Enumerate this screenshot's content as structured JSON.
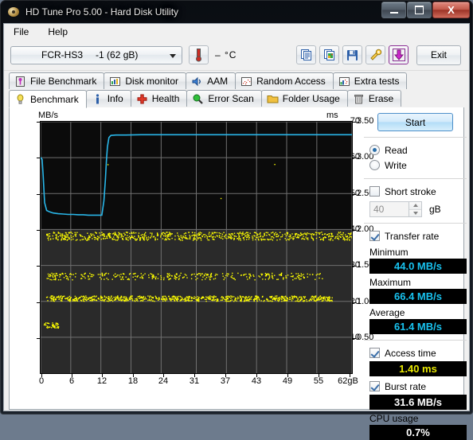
{
  "window": {
    "title": "HD Tune Pro 5.00 - Hard Disk Utility",
    "minimize_label": "Minimize",
    "maximize_label": "Maximize",
    "close_label": "X"
  },
  "menu": {
    "items": [
      {
        "label": "File"
      },
      {
        "label": "Help"
      }
    ]
  },
  "toolbar": {
    "device_name": "FCR-HS3",
    "device_detail": "-1 (62 gB)",
    "temperature": "– °C",
    "buttons": [
      {
        "name": "copy-button",
        "label": "Copy"
      },
      {
        "name": "copy-image-button",
        "label": "Copy image"
      },
      {
        "name": "save-button",
        "label": "Save"
      },
      {
        "name": "settings-button",
        "label": "Options"
      },
      {
        "name": "download-button",
        "label": "Download"
      }
    ],
    "exit_label": "Exit"
  },
  "tabs": {
    "row1": [
      {
        "label": "File Benchmark",
        "icon": "file-benchmark-icon"
      },
      {
        "label": "Disk monitor",
        "icon": "disk-monitor-icon"
      },
      {
        "label": "AAM",
        "icon": "aam-speaker-icon"
      },
      {
        "label": "Random Access",
        "icon": "random-access-icon"
      },
      {
        "label": "Extra tests",
        "icon": "extra-tests-icon"
      }
    ],
    "row2": [
      {
        "label": "Benchmark",
        "icon": "benchmark-bulb-icon",
        "active": true
      },
      {
        "label": "Info",
        "icon": "info-icon",
        "active": false
      },
      {
        "label": "Health",
        "icon": "health-cross-icon",
        "active": false
      },
      {
        "label": "Error Scan",
        "icon": "error-scan-magnifier-icon",
        "active": false
      },
      {
        "label": "Folder Usage",
        "icon": "folder-usage-icon",
        "active": false
      },
      {
        "label": "Erase",
        "icon": "erase-trash-icon",
        "active": false
      }
    ]
  },
  "results": {
    "start_label": "Start",
    "read_label": "Read",
    "write_label": "Write",
    "read_selected": true,
    "short_stroke_label": "Short stroke",
    "short_stroke_checked": false,
    "short_stroke_value": "40",
    "short_stroke_unit": "gB",
    "transfer_rate_label": "Transfer rate",
    "transfer_rate_checked": true,
    "minimum_label": "Minimum",
    "minimum_value": "44.0 MB/s",
    "maximum_label": "Maximum",
    "maximum_value": "66.4 MB/s",
    "average_label": "Average",
    "average_value": "61.4 MB/s",
    "access_time_label": "Access time",
    "access_time_checked": true,
    "access_time_value": "1.40 ms",
    "burst_rate_label": "Burst rate",
    "burst_rate_checked": true,
    "burst_rate_value": "31.6 MB/s",
    "cpu_usage_label": "CPU usage",
    "cpu_usage_value": "0.7%"
  },
  "colors": {
    "transfer_curve": "#29b6e8",
    "access_dots": "#ffff00",
    "plot_background": "#1c1c1c",
    "grid": "#6e6e6e",
    "value_cyan": "#18c3f0",
    "value_yellow": "#e8e800"
  },
  "chart_data": {
    "type": "line",
    "title": "",
    "ylabel": "MB/s",
    "y2label": "ms",
    "xlabel": "gB",
    "grid": true,
    "xlim": [
      0,
      62
    ],
    "ylim": [
      0,
      70
    ],
    "y2lim": [
      0,
      3.75
    ],
    "xticks": [
      0,
      6,
      12,
      18,
      24,
      31,
      37,
      43,
      49,
      55,
      62
    ],
    "xticklabels": [
      "0",
      "6",
      "12",
      "18",
      "24",
      "31",
      "37",
      "43",
      "49",
      "55",
      "62gB"
    ],
    "yticks": [
      10,
      20,
      30,
      40,
      50,
      60,
      70
    ],
    "yticklabels": [
      "10",
      "20",
      "30",
      "40",
      "50",
      "60",
      "70"
    ],
    "y2ticks": [
      0.5,
      1.0,
      1.5,
      2.0,
      2.5,
      3.0,
      3.5
    ],
    "y2ticklabels": [
      "0.50",
      "1.00",
      "1.50",
      "2.00",
      "2.50",
      "3.00",
      "3.50"
    ],
    "series": [
      {
        "name": "Transfer rate",
        "axis": "left",
        "units": "MB/s",
        "color": "#29b6e8",
        "x": [
          0.0,
          0.15,
          0.3,
          0.5,
          0.8,
          1.2,
          1.8,
          2.5,
          3.5,
          4.5,
          5.5,
          6.5,
          7.5,
          8.5,
          9.5,
          10.5,
          11.5,
          12.2,
          12.6,
          12.9,
          13.1,
          13.3,
          13.6,
          14.0,
          15.0,
          17.0,
          20.0,
          24.0,
          28.0,
          32.0,
          36.0,
          40.0,
          44.0,
          48.0,
          52.0,
          56.0,
          60.0,
          62.0
        ],
        "y": [
          60.1,
          59.8,
          59.5,
          55.0,
          47.5,
          45.3,
          44.9,
          44.6,
          44.4,
          44.3,
          44.2,
          44.2,
          44.1,
          44.1,
          44.0,
          44.0,
          44.0,
          44.0,
          48.0,
          54.0,
          59.0,
          63.0,
          65.6,
          66.2,
          66.3,
          66.3,
          66.4,
          66.4,
          66.4,
          66.4,
          66.4,
          66.4,
          66.4,
          66.4,
          66.4,
          66.4,
          66.4,
          66.4
        ]
      },
      {
        "name": "Access time",
        "axis": "right",
        "units": "ms",
        "color": "#ffff00",
        "marker": "dot",
        "description": "Scatter of access-time samples clustered in three horizontal bands near 1.05 ms, 1.40 ms and 2.05 ms, plus a small dense cluster near 0.70 ms at the start of the drive.",
        "bands": [
          {
            "center_ms": 2.05,
            "spread_ms": 0.06,
            "x_start": 1,
            "x_end": 62,
            "density": 0.85
          },
          {
            "center_ms": 1.45,
            "spread_ms": 0.05,
            "x_start": 1,
            "x_end": 56,
            "density": 0.45
          },
          {
            "center_ms": 1.12,
            "spread_ms": 0.04,
            "x_start": 1,
            "x_end": 58,
            "density": 0.95
          },
          {
            "center_ms": 0.72,
            "spread_ms": 0.04,
            "x_start": 0.5,
            "x_end": 3.5,
            "density": 1.0
          }
        ]
      }
    ],
    "summary": {
      "minimum_mbs": 44.0,
      "maximum_mbs": 66.4,
      "average_mbs": 61.4,
      "access_time_ms": 1.4,
      "burst_rate_mbs": 31.6,
      "cpu_usage_pct": 0.7
    }
  }
}
